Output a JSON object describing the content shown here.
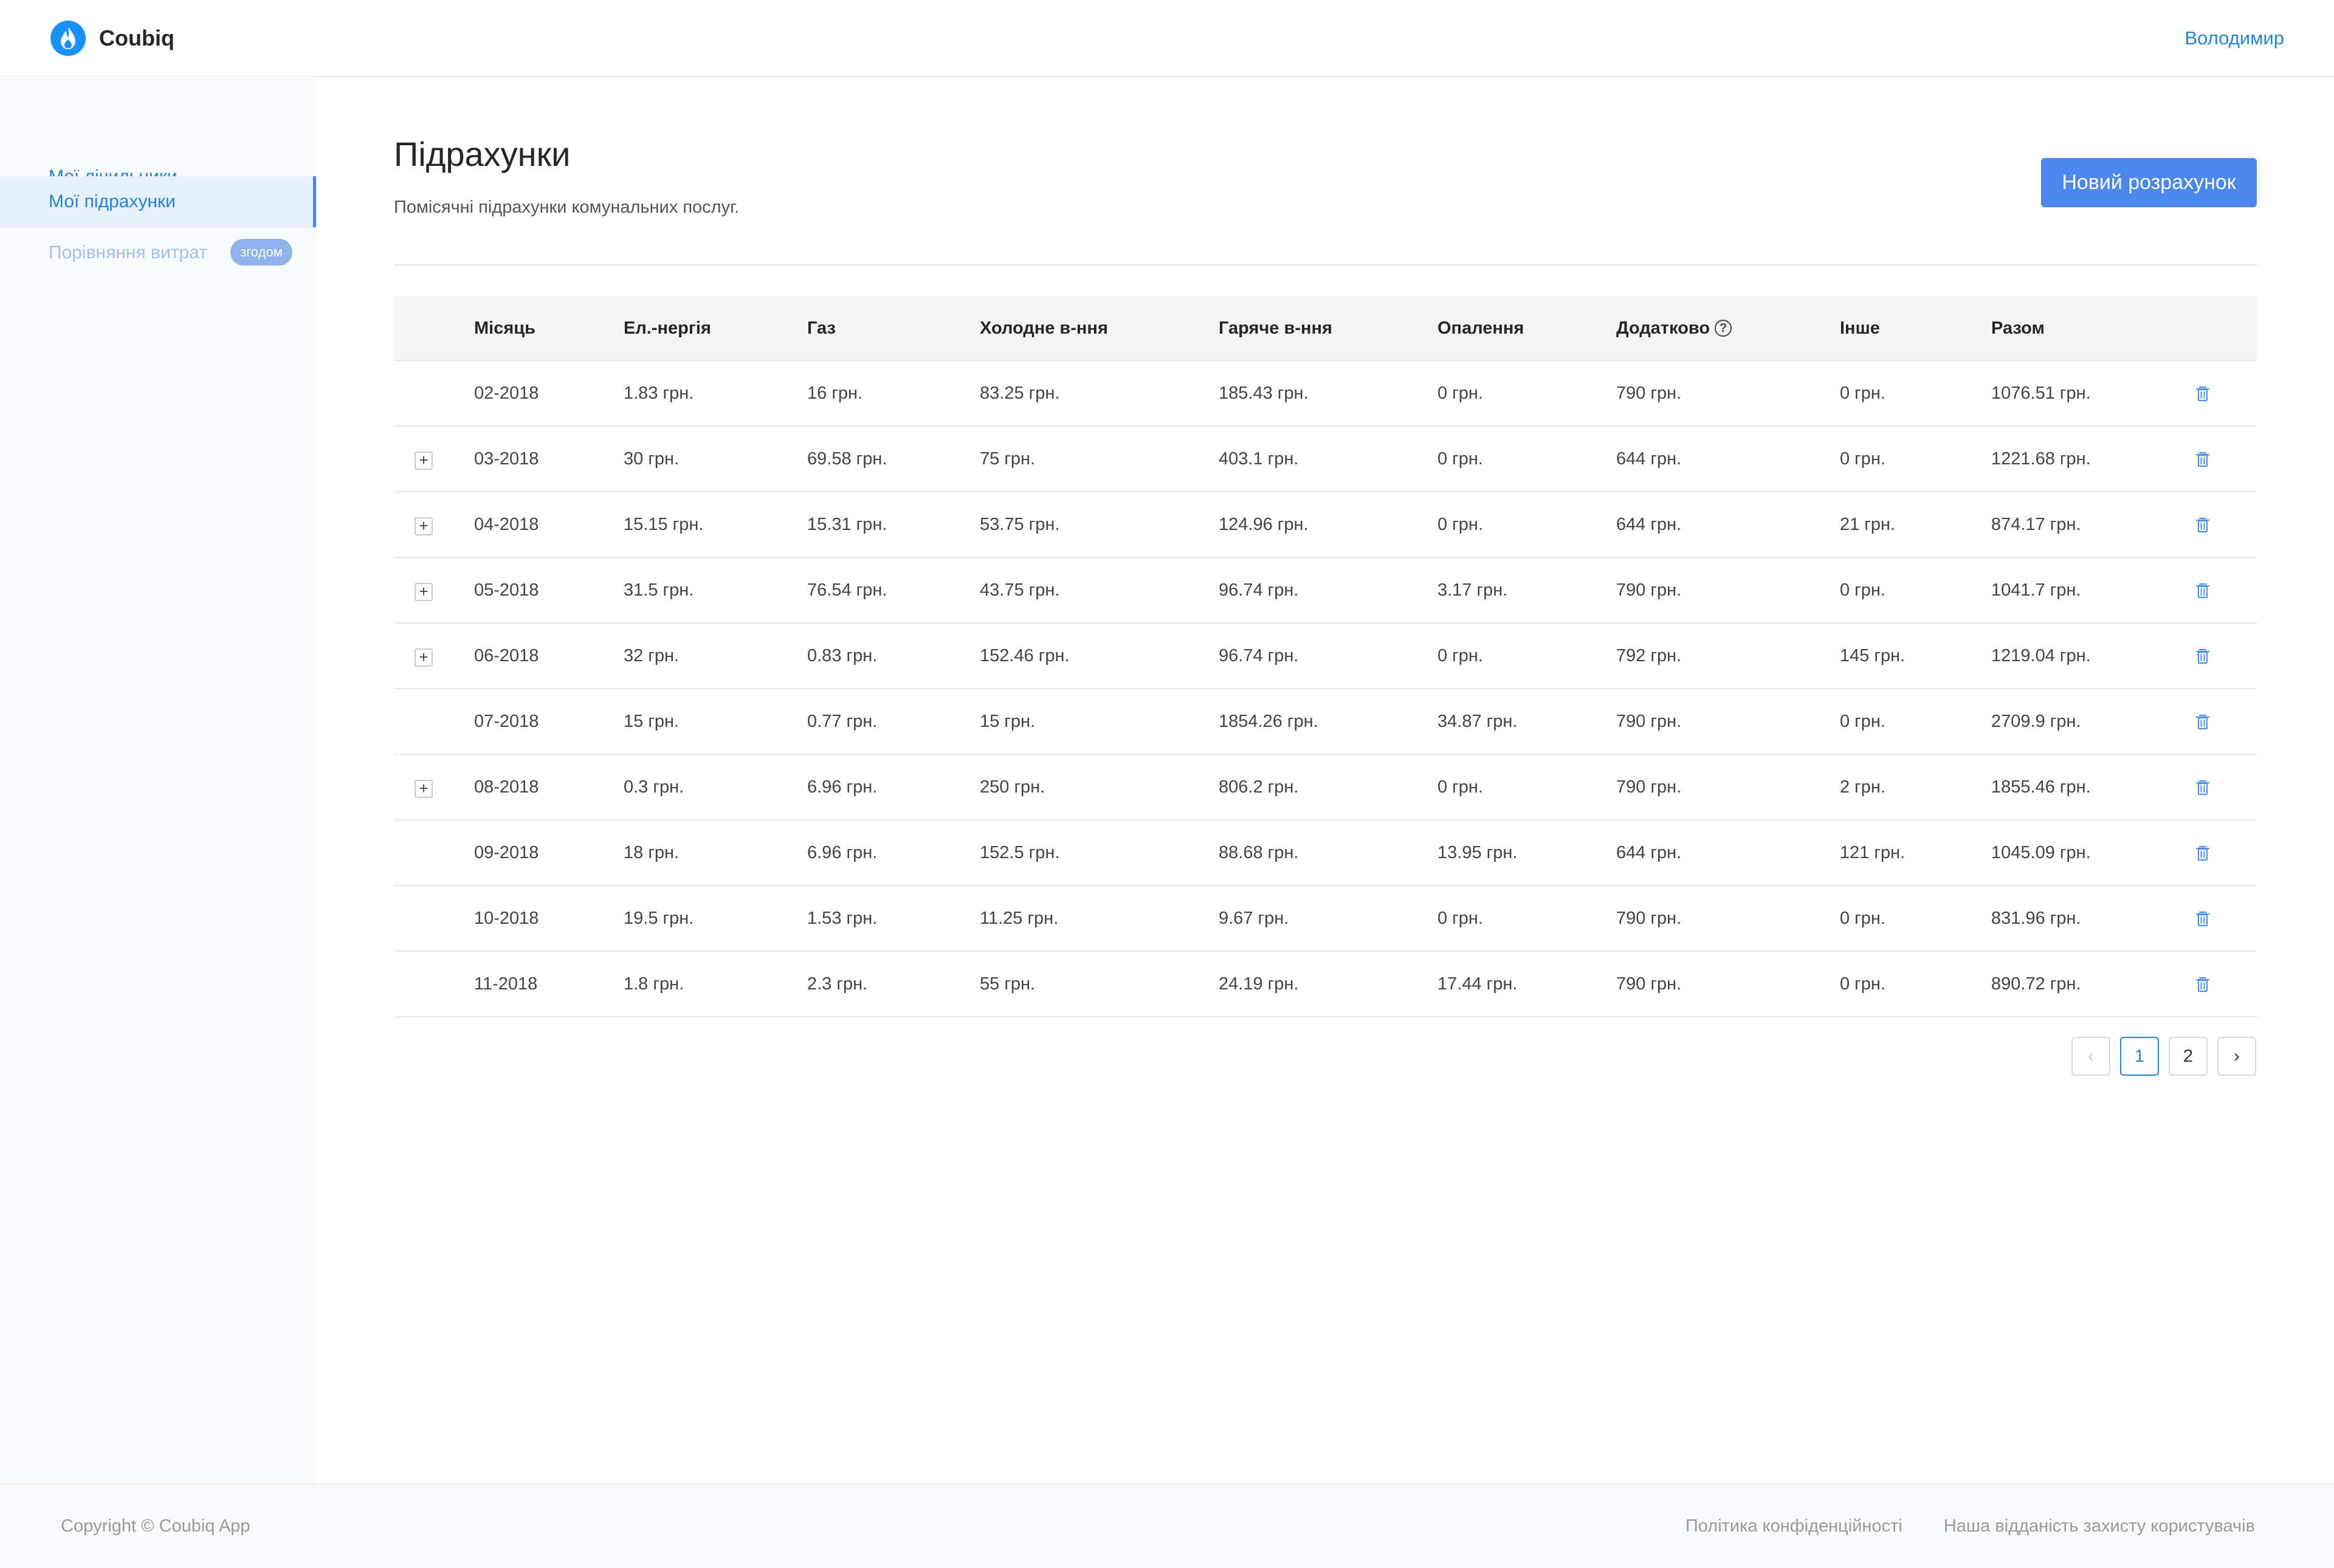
{
  "app": {
    "name": "Coubiq",
    "user": "Володимир"
  },
  "colors": {
    "accent": "#4c87ee",
    "link": "#1f86d9"
  },
  "sidebar": {
    "items": [
      {
        "label": "Мої лічильники",
        "state": "normal"
      },
      {
        "label": "Мої підрахунки",
        "state": "active"
      },
      {
        "label": "Порівняння витрат",
        "state": "disabled",
        "badge": "згодом"
      }
    ]
  },
  "page": {
    "title": "Підрахунки",
    "subtitle": "Помісячні підрахунки комунальних послуг.",
    "new_button": "Новий розрахунок"
  },
  "table": {
    "headers": {
      "month": "Місяць",
      "electricity": "Ел.-нергія",
      "gas": "Газ",
      "cold_water": "Холодне в-ння",
      "hot_water": "Гаряче в-ння",
      "heating": "Опалення",
      "extra": "Додатково",
      "other": "Інше",
      "total": "Разом"
    },
    "rows": [
      {
        "expandable": false,
        "month": "02-2018",
        "electricity": "1.83 грн.",
        "gas": "16 грн.",
        "cold_water": "83.25 грн.",
        "hot_water": "185.43 грн.",
        "heating": "0 грн.",
        "extra": "790 грн.",
        "other": "0 грн.",
        "total": "1076.51 грн."
      },
      {
        "expandable": true,
        "month": "03-2018",
        "electricity": "30 грн.",
        "gas": "69.58 грн.",
        "cold_water": "75 грн.",
        "hot_water": "403.1 грн.",
        "heating": "0 грн.",
        "extra": "644 грн.",
        "other": "0 грн.",
        "total": "1221.68 грн."
      },
      {
        "expandable": true,
        "month": "04-2018",
        "electricity": "15.15 грн.",
        "gas": "15.31 грн.",
        "cold_water": "53.75 грн.",
        "hot_water": "124.96 грн.",
        "heating": "0 грн.",
        "extra": "644 грн.",
        "other": "21 грн.",
        "total": "874.17 грн."
      },
      {
        "expandable": true,
        "month": "05-2018",
        "electricity": "31.5 грн.",
        "gas": "76.54 грн.",
        "cold_water": "43.75 грн.",
        "hot_water": "96.74 грн.",
        "heating": "3.17 грн.",
        "extra": "790 грн.",
        "other": "0 грн.",
        "total": "1041.7 грн."
      },
      {
        "expandable": true,
        "month": "06-2018",
        "electricity": "32 грн.",
        "gas": "0.83 грн.",
        "cold_water": "152.46 грн.",
        "hot_water": "96.74 грн.",
        "heating": "0 грн.",
        "extra": "792 грн.",
        "other": "145 грн.",
        "total": "1219.04 грн."
      },
      {
        "expandable": false,
        "month": "07-2018",
        "electricity": "15 грн.",
        "gas": "0.77 грн.",
        "cold_water": "15 грн.",
        "hot_water": "1854.26 грн.",
        "heating": "34.87 грн.",
        "extra": "790 грн.",
        "other": "0 грн.",
        "total": "2709.9 грн."
      },
      {
        "expandable": true,
        "month": "08-2018",
        "electricity": "0.3 грн.",
        "gas": "6.96 грн.",
        "cold_water": "250 грн.",
        "hot_water": "806.2 грн.",
        "heating": "0 грн.",
        "extra": "790 грн.",
        "other": "2 грн.",
        "total": "1855.46 грн."
      },
      {
        "expandable": false,
        "month": "09-2018",
        "electricity": "18 грн.",
        "gas": "6.96 грн.",
        "cold_water": "152.5 грн.",
        "hot_water": "88.68 грн.",
        "heating": "13.95 грн.",
        "extra": "644 грн.",
        "other": "121 грн.",
        "total": "1045.09 грн."
      },
      {
        "expandable": false,
        "month": "10-2018",
        "electricity": "19.5 грн.",
        "gas": "1.53 грн.",
        "cold_water": "11.25 грн.",
        "hot_water": "9.67 грн.",
        "heating": "0 грн.",
        "extra": "790 грн.",
        "other": "0 грн.",
        "total": "831.96 грн."
      },
      {
        "expandable": false,
        "month": "11-2018",
        "electricity": "1.8 грн.",
        "gas": "2.3 грн.",
        "cold_water": "55 грн.",
        "hot_water": "24.19 грн.",
        "heating": "17.44 грн.",
        "extra": "790 грн.",
        "other": "0 грн.",
        "total": "890.72 грн."
      }
    ]
  },
  "pagination": {
    "pages": [
      "1",
      "2"
    ],
    "current": "1",
    "prev": "‹",
    "next": "›"
  },
  "footer": {
    "copyright": "Copyright © Coubiq App",
    "links": [
      "Політика конфіденційності",
      "Наша відданість захисту користувачів"
    ]
  }
}
